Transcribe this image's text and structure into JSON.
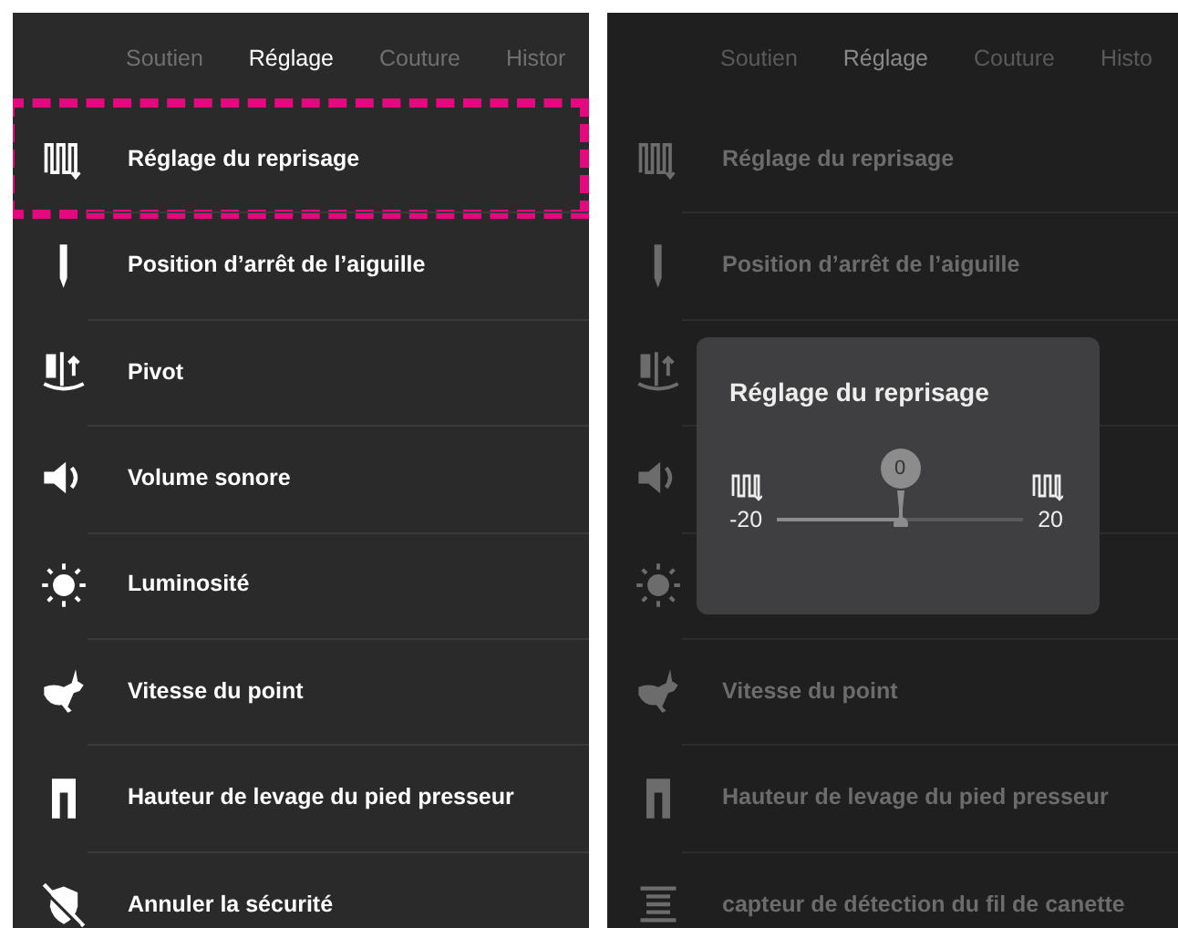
{
  "screens": [
    {
      "dimmed": false,
      "tabs": [
        {
          "label": "Soutien",
          "selected": false
        },
        {
          "label": "Réglage",
          "selected": true
        },
        {
          "label": "Couture",
          "selected": false
        },
        {
          "label": "Histor",
          "selected": false
        }
      ],
      "items": [
        {
          "kind": "darning",
          "label": "Réglage du reprisage",
          "highlighted": true
        },
        {
          "kind": "needle",
          "label": "Position d’arrêt de l’aiguille",
          "highlighted": false
        },
        {
          "kind": "pivot",
          "label": "Pivot",
          "highlighted": false
        },
        {
          "kind": "volume",
          "label": "Volume sonore",
          "highlighted": false
        },
        {
          "kind": "brightness",
          "label": "Luminosité",
          "highlighted": false
        },
        {
          "kind": "speed",
          "label": "Vitesse du point",
          "highlighted": false
        },
        {
          "kind": "foot",
          "label": "Hauteur de levage du pied presseur",
          "highlighted": false
        },
        {
          "kind": "safety",
          "label": "Annuler la sécurité",
          "highlighted": false
        }
      ]
    },
    {
      "dimmed": true,
      "tabs": [
        {
          "label": "Soutien",
          "selected": false
        },
        {
          "label": "Réglage",
          "selected": true
        },
        {
          "label": "Couture",
          "selected": false
        },
        {
          "label": "Histo",
          "selected": false
        }
      ],
      "items": [
        {
          "kind": "darning",
          "label": "Réglage du reprisage"
        },
        {
          "kind": "needle",
          "label": "Position d’arrêt de l’aiguille"
        },
        {
          "kind": "pivot"
        },
        {
          "kind": "volume"
        },
        {
          "kind": "brightness"
        },
        {
          "kind": "speed",
          "label": "Vitesse du point"
        },
        {
          "kind": "foot",
          "label": "Hauteur de levage du pied presseur"
        },
        {
          "kind": "bobbin",
          "label": "capteur de détection du fil de canette"
        }
      ],
      "dialog": {
        "title": "Réglage du reprisage",
        "min_label": "-20",
        "max_label": "20",
        "value": "0",
        "level": 0.5
      }
    }
  ]
}
